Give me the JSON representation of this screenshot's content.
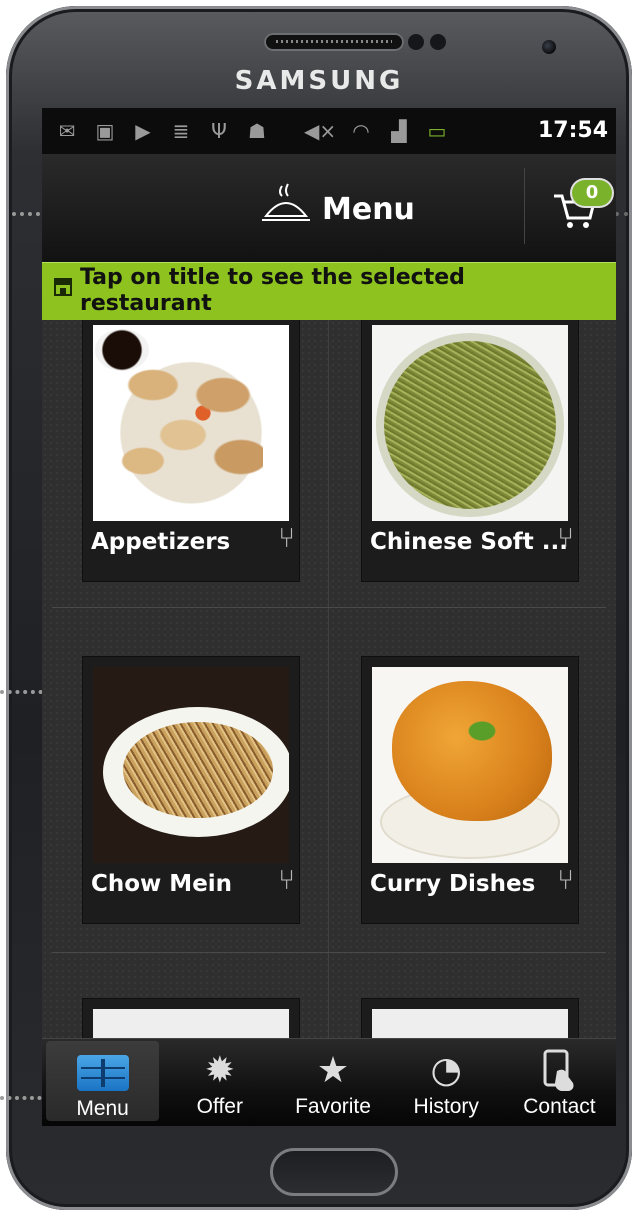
{
  "device": {
    "brand": "SAMSUNG"
  },
  "status_bar": {
    "time": "17:54",
    "icons": [
      "gmail-icon",
      "chat-icon",
      "play-store-icon",
      "no-signal-icon",
      "usb-icon",
      "android-debug-icon",
      "mute-icon",
      "wifi-icon",
      "signal-icon",
      "battery-icon"
    ]
  },
  "action_bar": {
    "title": "Menu",
    "title_icon": "serving-dish-icon",
    "cart_count": "0"
  },
  "banner": {
    "icon": "store-icon",
    "text": "Tap on title to see the selected restaurant"
  },
  "categories": [
    {
      "label": "Appetizers",
      "image": "appetizers-photo"
    },
    {
      "label": "Chinese Soft ...",
      "image": "chinese-soft-noodles-photo"
    },
    {
      "label": "Chow Mein",
      "image": "chow-mein-photo"
    },
    {
      "label": "Curry Dishes",
      "image": "curry-dishes-photo"
    }
  ],
  "tabs": [
    {
      "label": "Menu",
      "icon": "menu-grid-icon",
      "active": true
    },
    {
      "label": "Offer",
      "icon": "starburst-icon",
      "active": false
    },
    {
      "label": "Favorite",
      "icon": "star-icon",
      "active": false
    },
    {
      "label": "History",
      "icon": "history-clock-icon",
      "active": false
    },
    {
      "label": "Contact",
      "icon": "contact-phone-icon",
      "active": false
    }
  ],
  "colors": {
    "banner": "#8dc21f",
    "cart_badge": "#7bb22b",
    "menu_icon": "#2a8ad6"
  }
}
